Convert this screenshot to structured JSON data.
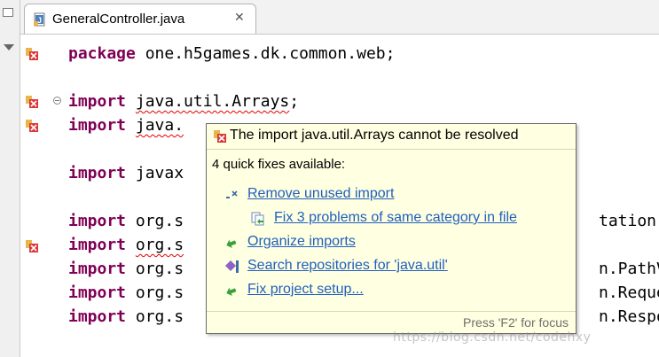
{
  "tab": {
    "title": "GeneralController.java",
    "close": "✕"
  },
  "editor": {
    "lines": [
      {
        "kw": "package",
        "rest": " one.h5games.dk.common.web;"
      },
      {
        "kw": "import",
        "err": "java.util.Arrays",
        "rest": ";"
      },
      {
        "kw": "import",
        "err": "java.",
        "rest": ""
      },
      {
        "kw": "import",
        "rest": " javax"
      },
      {
        "kw": "import",
        "rest": " org.s",
        "right": "tation."
      },
      {
        "kw": "import",
        "err": "org.s",
        "rest": ""
      },
      {
        "kw": "import",
        "rest": " org.s",
        "right": "n.PathV"
      },
      {
        "kw": "import",
        "rest": " org.s",
        "right": "n.Reque"
      },
      {
        "kw": "import",
        "rest": " org.s",
        "right": "n.Respo"
      }
    ]
  },
  "quickfix": {
    "title": "The import java.util.Arrays cannot be resolved",
    "count": "4 quick fixes available:",
    "items": [
      {
        "label": "Remove unused import",
        "icon": "remove-import-icon"
      },
      {
        "label": "Fix 3 problems of same category in file",
        "icon": "multi-fix-icon"
      },
      {
        "label": "Organize imports",
        "icon": "organize-imports-icon"
      },
      {
        "label": "Search repositories for 'java.util'",
        "icon": "search-repo-icon"
      },
      {
        "label": "Fix project setup...",
        "icon": "project-setup-icon"
      }
    ],
    "footer": "Press 'F2' for focus"
  },
  "watermark": "https://blog.csdn.net/codehxy",
  "colors": {
    "keyword": "#7f0055",
    "link": "#1f5fbf",
    "popup_bg": "#ffffe1",
    "error": "#e60000"
  }
}
